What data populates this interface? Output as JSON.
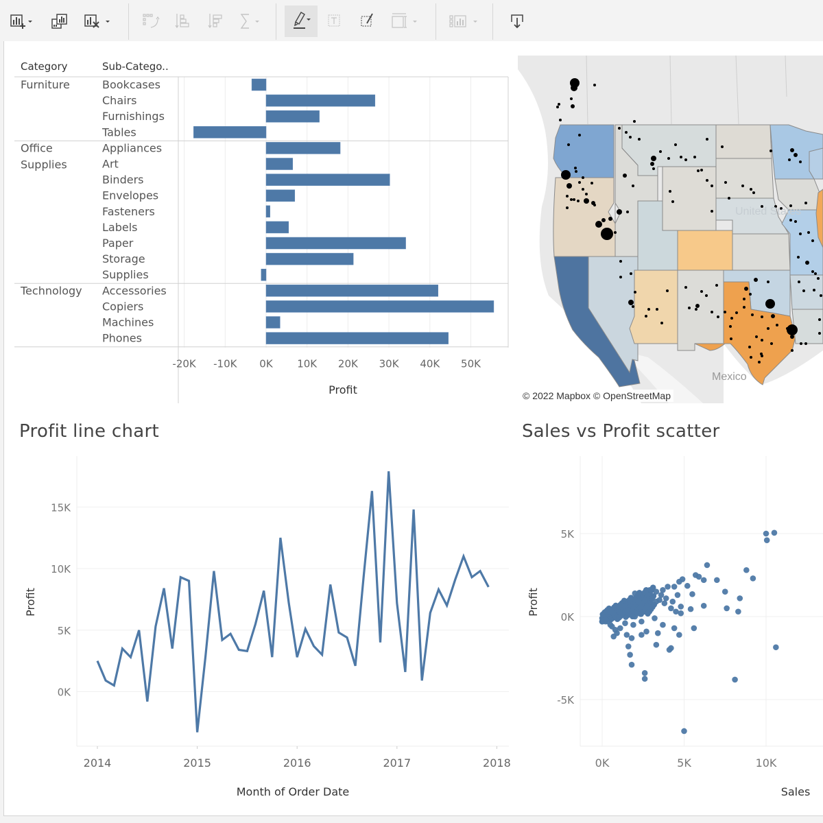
{
  "toolbar": {
    "buttons": [
      {
        "name": "new-worksheet",
        "enabled": true,
        "dropdown": true
      },
      {
        "name": "duplicate-sheet",
        "enabled": true,
        "dropdown": false
      },
      {
        "name": "clear-sheet",
        "enabled": true,
        "dropdown": true
      },
      {
        "name": "swap-rows-columns",
        "enabled": false,
        "dropdown": false
      },
      {
        "name": "sort-ascending",
        "enabled": false,
        "dropdown": false
      },
      {
        "name": "sort-descending",
        "enabled": false,
        "dropdown": false
      },
      {
        "name": "totals",
        "enabled": false,
        "dropdown": true
      },
      {
        "name": "highlight",
        "enabled": true,
        "dropdown": true,
        "active": true
      },
      {
        "name": "show-mark-labels",
        "enabled": false,
        "dropdown": false
      },
      {
        "name": "fix-axes",
        "enabled": true,
        "dropdown": false
      },
      {
        "name": "fit",
        "enabled": false,
        "dropdown": true
      },
      {
        "name": "show-me",
        "enabled": false,
        "dropdown": true
      },
      {
        "name": "download",
        "enabled": true,
        "dropdown": false
      }
    ]
  },
  "colors": {
    "bar": "#4e79a7",
    "grid": "#ececec",
    "axis_text": "#666666",
    "map_land": "#e6e6e6"
  },
  "bar_panel": {
    "col_headers": [
      "Category",
      "Sub-Catego.."
    ],
    "axis_ticks": [
      "-20K",
      "-10K",
      "0K",
      "10K",
      "20K",
      "30K",
      "40K",
      "50K"
    ],
    "axis_title": "Profit"
  },
  "map_panel": {
    "attribution": "© 2022 Mapbox  © OpenStreetMap",
    "labels": {
      "country": "United States",
      "mexico": "Mexico"
    },
    "states": [
      {
        "name": "Washington",
        "color": "#7fa6d1"
      },
      {
        "name": "Oregon",
        "color": "#e4d7c4"
      },
      {
        "name": "California",
        "color": "#4e74a0"
      },
      {
        "name": "Nevada",
        "color": "#cad6de"
      },
      {
        "name": "Idaho",
        "color": "#dcdcd8"
      },
      {
        "name": "Montana",
        "color": "#d6dcdc"
      },
      {
        "name": "Wyoming",
        "color": "#dedcd6"
      },
      {
        "name": "Utah",
        "color": "#ccd8dc"
      },
      {
        "name": "Arizona",
        "color": "#f0d6ac"
      },
      {
        "name": "Colorado",
        "color": "#f7c98a"
      },
      {
        "name": "New Mexico",
        "color": "#dcdcd8"
      },
      {
        "name": "North Dakota",
        "color": "#dedbd4"
      },
      {
        "name": "South Dakota",
        "color": "#deddd8"
      },
      {
        "name": "Nebraska",
        "color": "#d6dde0"
      },
      {
        "name": "Kansas",
        "color": "#dcdcd8"
      },
      {
        "name": "Oklahoma",
        "color": "#c4d5e2"
      },
      {
        "name": "Texas",
        "color": "#eea14e"
      },
      {
        "name": "Minnesota",
        "color": "#a9c8e4"
      },
      {
        "name": "Iowa",
        "color": "#dcdcd8"
      },
      {
        "name": "Missouri",
        "color": "#b3cfe8"
      },
      {
        "name": "Arkansas",
        "color": "#ccd8e0"
      },
      {
        "name": "Louisiana",
        "color": "#d6dcdc"
      },
      {
        "name": "Wisconsin",
        "color": "#b6cfe6"
      },
      {
        "name": "Illinois",
        "color": "#f0a85a"
      }
    ]
  },
  "line_panel": {
    "title": "Profit line chart"
  },
  "scatter_panel": {
    "title": "Sales vs Profit scatter"
  },
  "chart_data": [
    {
      "type": "bar",
      "orientation": "horizontal",
      "title": "",
      "xlabel": "Profit",
      "ylabel": "",
      "xlim": [
        -21000,
        59000
      ],
      "x_ticks": [
        -20000,
        -10000,
        0,
        10000,
        20000,
        30000,
        40000,
        50000
      ],
      "grid": true,
      "groups": [
        {
          "category": "Furniture",
          "subcategories": [
            "Bookcases",
            "Chairs",
            "Furnishings",
            "Tables"
          ],
          "values": [
            -3500,
            26600,
            13000,
            -17700
          ]
        },
        {
          "category": "Office\nSupplies",
          "subcategories": [
            "Appliances",
            "Art",
            "Binders",
            "Envelopes",
            "Fasteners",
            "Labels",
            "Paper",
            "Storage",
            "Supplies"
          ],
          "values": [
            18100,
            6500,
            30200,
            7000,
            950,
            5500,
            34100,
            21300,
            -1200
          ]
        },
        {
          "category": "Technology",
          "subcategories": [
            "Accessories",
            "Copiers",
            "Machines",
            "Phones"
          ],
          "values": [
            42000,
            55600,
            3400,
            44500
          ]
        }
      ]
    },
    {
      "type": "line",
      "title": "Profit line chart",
      "xlabel": "Month of Order Date",
      "ylabel": "Profit",
      "x_start": "2014-01",
      "x_ticks": [
        "2014",
        "2015",
        "2016",
        "2017",
        "2018"
      ],
      "y_ticks": [
        "0K",
        "5K",
        "10K",
        "15K"
      ],
      "ylim": [
        -4500,
        19000
      ],
      "grid": true,
      "values": [
        2500,
        900,
        500,
        3500,
        2800,
        5000,
        -800,
        5300,
        8400,
        3500,
        9300,
        9000,
        -3300,
        2900,
        9800,
        4200,
        4700,
        3400,
        3300,
        5500,
        8200,
        2800,
        12500,
        7200,
        2800,
        5100,
        3700,
        3000,
        8700,
        4800,
        4400,
        2100,
        9400,
        16300,
        4000,
        17900,
        7200,
        1600,
        14800,
        900,
        6400,
        8300,
        7000,
        9100,
        11000,
        9300,
        9800,
        8500
      ]
    },
    {
      "type": "scatter",
      "title": "Sales vs Profit scatter",
      "xlabel": "Sales",
      "ylabel": "Profit",
      "x_ticks": [
        "0K",
        "5K",
        "10K"
      ],
      "y_ticks": [
        "5K",
        "0K",
        "-5K"
      ],
      "xlim": [
        -1300,
        13500
      ],
      "ylim": [
        -8000,
        9500
      ],
      "grid": true,
      "points": [
        [
          10000,
          5000
        ],
        [
          10050,
          4600
        ],
        [
          10500,
          5050
        ],
        [
          6400,
          3100
        ],
        [
          8800,
          2800
        ],
        [
          9200,
          2300
        ],
        [
          7000,
          2200
        ],
        [
          7500,
          1500
        ],
        [
          8400,
          1100
        ],
        [
          7600,
          500
        ],
        [
          8300,
          300
        ],
        [
          10600,
          -1850
        ],
        [
          8100,
          -3800
        ],
        [
          5000,
          -6900
        ],
        [
          2600,
          -3400
        ],
        [
          2600,
          -3750
        ],
        [
          1800,
          -2900
        ],
        [
          1700,
          -2300
        ],
        [
          1600,
          -1800
        ],
        [
          3300,
          -1700
        ],
        [
          4200,
          -1900
        ],
        [
          4100,
          -2000
        ],
        [
          3400,
          -1000
        ],
        [
          4700,
          -1100
        ],
        [
          4400,
          -700
        ],
        [
          5600,
          -700
        ],
        [
          3700,
          -500
        ],
        [
          2400,
          -1100
        ],
        [
          2700,
          -900
        ],
        [
          3200,
          -100
        ],
        [
          5500,
          1350
        ],
        [
          5200,
          1850
        ],
        [
          5700,
          2500
        ],
        [
          5900,
          2400
        ],
        [
          4900,
          2250
        ],
        [
          4700,
          2100
        ],
        [
          6200,
          2200
        ],
        [
          6200,
          650
        ],
        [
          5400,
          450
        ],
        [
          4800,
          200
        ],
        [
          4500,
          300
        ],
        [
          4800,
          600
        ],
        [
          4000,
          1800
        ],
        [
          4400,
          1800
        ],
        [
          4600,
          1300
        ],
        [
          3300,
          1500
        ],
        [
          3600,
          1300
        ],
        [
          3000,
          1200
        ],
        [
          2500,
          1000
        ],
        [
          2900,
          500
        ],
        [
          3800,
          800
        ],
        [
          4200,
          500
        ],
        [
          1900,
          600
        ],
        [
          1500,
          700
        ],
        [
          1200,
          500
        ],
        [
          900,
          300
        ],
        [
          600,
          200
        ],
        [
          300,
          100
        ],
        [
          100,
          0
        ],
        [
          0,
          -100
        ],
        [
          200,
          -300
        ],
        [
          500,
          -500
        ],
        [
          800,
          -800
        ],
        [
          700,
          -1200
        ],
        [
          1100,
          -700
        ],
        [
          1400,
          -400
        ],
        [
          1900,
          -500
        ],
        [
          2200,
          200
        ],
        [
          2600,
          300
        ],
        [
          3100,
          700
        ],
        [
          3500,
          1000
        ],
        [
          1700,
          1000
        ],
        [
          2200,
          1100
        ],
        [
          2700,
          1300
        ],
        [
          1300,
          400
        ],
        [
          1000,
          100
        ],
        [
          1600,
          200
        ],
        [
          2000,
          0
        ],
        [
          2400,
          -300
        ],
        [
          900,
          -1000
        ],
        [
          1500,
          -1100
        ],
        [
          1800,
          -1300
        ],
        [
          600,
          -600
        ],
        [
          350,
          -300
        ],
        [
          50,
          -250
        ],
        [
          400,
          150
        ],
        [
          700,
          350
        ],
        [
          1100,
          700
        ],
        [
          1500,
          900
        ],
        [
          2000,
          900
        ],
        [
          2300,
          600
        ],
        [
          2800,
          800
        ],
        [
          3300,
          900
        ],
        [
          3700,
          1600
        ],
        [
          3900,
          1100
        ],
        [
          4300,
          900
        ],
        [
          2900,
          1600
        ],
        [
          2000,
          1400
        ],
        [
          1200,
          800
        ],
        [
          800,
          600
        ],
        [
          500,
          400
        ],
        [
          150,
          250
        ],
        [
          2500,
          500
        ]
      ]
    }
  ]
}
